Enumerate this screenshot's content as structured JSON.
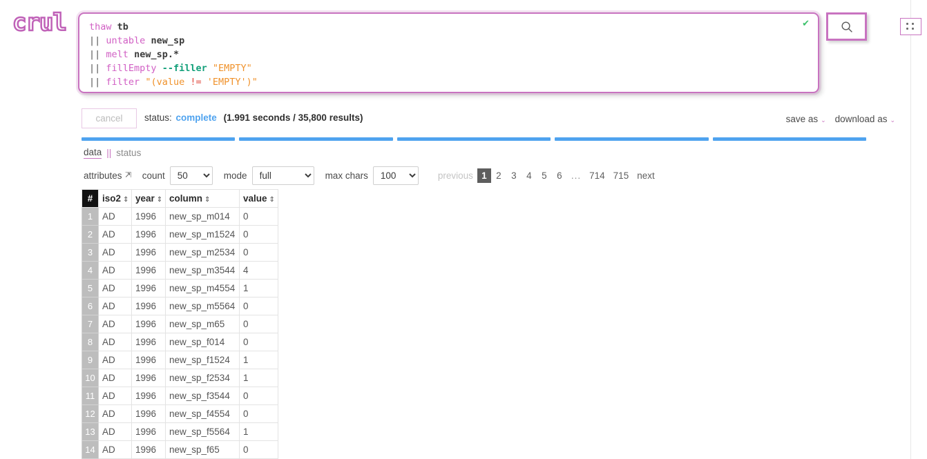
{
  "brand": {
    "logo_text": "crul",
    "registered_mark": "®",
    "accent": "#c873c0",
    "blue": "#4fa3ef"
  },
  "editor": {
    "valid_icon": "check-icon",
    "valid_glyph": "✔",
    "lines": [
      {
        "tokens": [
          {
            "t": "thaw",
            "c": "cmd"
          },
          {
            "t": " ",
            "c": "plain"
          },
          {
            "t": "tb",
            "c": "ident"
          }
        ]
      },
      {
        "tokens": [
          {
            "t": "||",
            "c": "pipe"
          },
          {
            "t": " ",
            "c": "plain"
          },
          {
            "t": "untable",
            "c": "cmd"
          },
          {
            "t": " ",
            "c": "plain"
          },
          {
            "t": "new_sp",
            "c": "ident"
          }
        ]
      },
      {
        "tokens": [
          {
            "t": "||",
            "c": "pipe"
          },
          {
            "t": " ",
            "c": "plain"
          },
          {
            "t": "melt",
            "c": "cmd"
          },
          {
            "t": " ",
            "c": "plain"
          },
          {
            "t": "new_sp.*",
            "c": "ident"
          }
        ]
      },
      {
        "tokens": [
          {
            "t": "||",
            "c": "pipe"
          },
          {
            "t": " ",
            "c": "plain"
          },
          {
            "t": "fillEmpty",
            "c": "cmd"
          },
          {
            "t": " ",
            "c": "plain"
          },
          {
            "t": "--filler",
            "c": "flag"
          },
          {
            "t": " ",
            "c": "plain"
          },
          {
            "t": "\"EMPTY\"",
            "c": "str"
          }
        ]
      },
      {
        "tokens": [
          {
            "t": "||",
            "c": "pipe"
          },
          {
            "t": " ",
            "c": "plain"
          },
          {
            "t": "filter",
            "c": "cmd"
          },
          {
            "t": " ",
            "c": "plain"
          },
          {
            "t": "\"(value ",
            "c": "str"
          },
          {
            "t": "!=",
            "c": "op"
          },
          {
            "t": " 'EMPTY')\"",
            "c": "str"
          }
        ]
      }
    ]
  },
  "toolbar": {
    "search_icon": "search-icon",
    "grid_icon": "grid-dots-icon"
  },
  "status": {
    "cancel_label": "cancel",
    "status_label": "status:",
    "status_value": "complete",
    "meta": "(1.991 seconds / 35,800 results)",
    "save_as_label": "save as",
    "download_as_label": "download as",
    "caret_glyph": "⌄",
    "segments": 5
  },
  "tabs": {
    "active": "data",
    "separator": "||",
    "inactive": "status"
  },
  "controls": {
    "attributes_label": "attributes",
    "attributes_icon": "collapse-arrow-icon",
    "count_label": "count",
    "count_value": "50",
    "count_options": [
      "50"
    ],
    "mode_label": "mode",
    "mode_value": "full",
    "mode_options": [
      "full"
    ],
    "maxchars_label": "max chars",
    "maxchars_value": "100",
    "maxchars_options": [
      "100"
    ]
  },
  "pagination": {
    "previous_label": "previous",
    "next_label": "next",
    "current": "1",
    "pages": [
      "1",
      "2",
      "3",
      "4",
      "5",
      "6",
      "...",
      "714",
      "715"
    ]
  },
  "table": {
    "index_header": "#",
    "columns": [
      {
        "label": "iso2",
        "sortable": true
      },
      {
        "label": "year",
        "sortable": true
      },
      {
        "label": "column",
        "sortable": true
      },
      {
        "label": "value",
        "sortable": true
      }
    ],
    "sort_glyph": "⇕",
    "rows": [
      {
        "idx": "1",
        "iso2": "AD",
        "year": "1996",
        "column": "new_sp_m014",
        "value": "0"
      },
      {
        "idx": "2",
        "iso2": "AD",
        "year": "1996",
        "column": "new_sp_m1524",
        "value": "0"
      },
      {
        "idx": "3",
        "iso2": "AD",
        "year": "1996",
        "column": "new_sp_m2534",
        "value": "0"
      },
      {
        "idx": "4",
        "iso2": "AD",
        "year": "1996",
        "column": "new_sp_m3544",
        "value": "4"
      },
      {
        "idx": "5",
        "iso2": "AD",
        "year": "1996",
        "column": "new_sp_m4554",
        "value": "1"
      },
      {
        "idx": "6",
        "iso2": "AD",
        "year": "1996",
        "column": "new_sp_m5564",
        "value": "0"
      },
      {
        "idx": "7",
        "iso2": "AD",
        "year": "1996",
        "column": "new_sp_m65",
        "value": "0"
      },
      {
        "idx": "8",
        "iso2": "AD",
        "year": "1996",
        "column": "new_sp_f014",
        "value": "0"
      },
      {
        "idx": "9",
        "iso2": "AD",
        "year": "1996",
        "column": "new_sp_f1524",
        "value": "1"
      },
      {
        "idx": "10",
        "iso2": "AD",
        "year": "1996",
        "column": "new_sp_f2534",
        "value": "1"
      },
      {
        "idx": "11",
        "iso2": "AD",
        "year": "1996",
        "column": "new_sp_f3544",
        "value": "0"
      },
      {
        "idx": "12",
        "iso2": "AD",
        "year": "1996",
        "column": "new_sp_f4554",
        "value": "0"
      },
      {
        "idx": "13",
        "iso2": "AD",
        "year": "1996",
        "column": "new_sp_f5564",
        "value": "1"
      },
      {
        "idx": "14",
        "iso2": "AD",
        "year": "1996",
        "column": "new_sp_f65",
        "value": "0"
      }
    ]
  }
}
